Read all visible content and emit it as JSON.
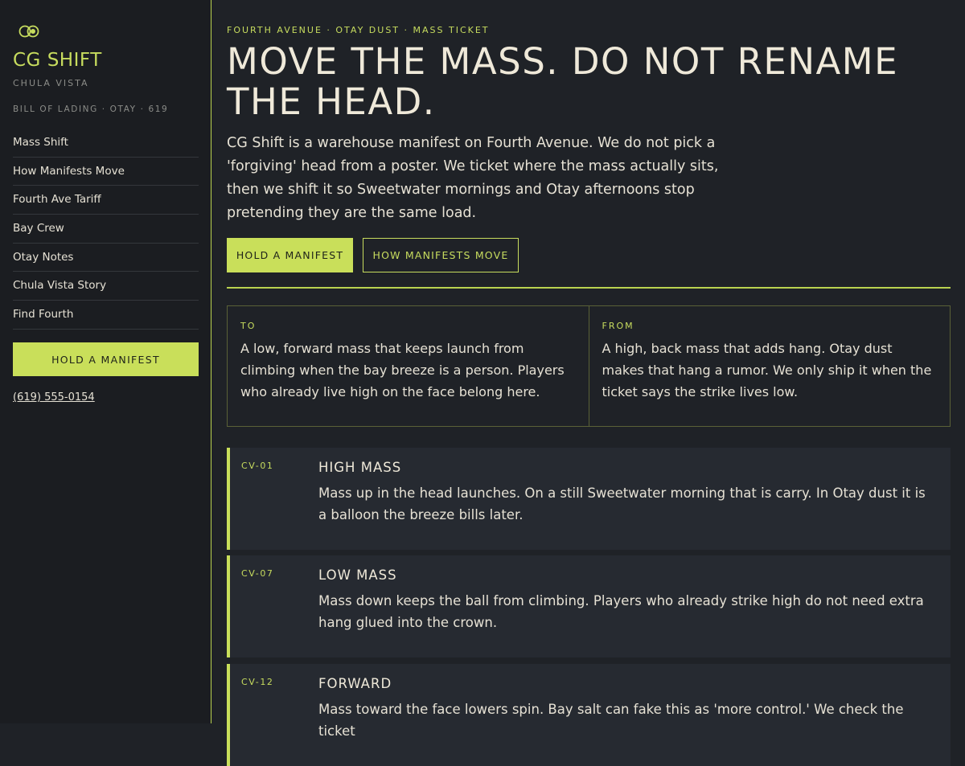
{
  "brand": {
    "name": "CG SHIFT",
    "location": "CHULA VISTA",
    "bill": "BILL OF LADING · OTAY · 619"
  },
  "nav": [
    {
      "label": "Mass Shift"
    },
    {
      "label": "How Manifests Move"
    },
    {
      "label": "Fourth Ave Tariff"
    },
    {
      "label": "Bay Crew"
    },
    {
      "label": "Otay Notes"
    },
    {
      "label": "Chula Vista Story"
    },
    {
      "label": "Find Fourth"
    }
  ],
  "sidebar": {
    "cta_label": "HOLD A MANIFEST",
    "phone": "(619) 555-0154"
  },
  "hero": {
    "eyebrow": "FOURTH AVENUE · OTAY DUST · MASS TICKET",
    "headline": "MOVE THE MASS. DO NOT RENAME THE HEAD.",
    "intro": "CG Shift is a warehouse manifest on Fourth Avenue. We do not pick a 'forgiving' head from a poster. We ticket where the mass actually sits, then we shift it so Sweetwater mornings and Otay afternoons stop pretending they are the same load.",
    "primary_label": "HOLD A MANIFEST",
    "secondary_label": "HOW MANIFESTS MOVE"
  },
  "compare": {
    "to": {
      "label": "TO",
      "text": "A low, forward mass that keeps launch from climbing when the bay breeze is a person. Players who already live high on the face belong here."
    },
    "from": {
      "label": "FROM",
      "text": "A high, back mass that adds hang. Otay dust makes that hang a rumor. We only ship it when the ticket says the strike lives low."
    }
  },
  "cards": [
    {
      "code": "CV-01",
      "title": "HIGH MASS",
      "body": "Mass up in the head launches. On a still Sweetwater morning that is carry. In Otay dust it is a balloon the breeze bills later."
    },
    {
      "code": "CV-07",
      "title": "LOW MASS",
      "body": "Mass down keeps the ball from climbing. Players who already strike high do not need extra hang glued into the crown."
    },
    {
      "code": "CV-12",
      "title": "FORWARD",
      "body": "Mass toward the face lowers spin. Bay salt can fake this as 'more control.' We check the ticket"
    }
  ],
  "colors": {
    "accent": "#c9df5a",
    "background": "#1f2227",
    "sidebar": "#1b1d21",
    "card": "#262a31",
    "text": "#e6e1d4"
  },
  "icons": {
    "logo": "twin-rings-logo-icon"
  }
}
